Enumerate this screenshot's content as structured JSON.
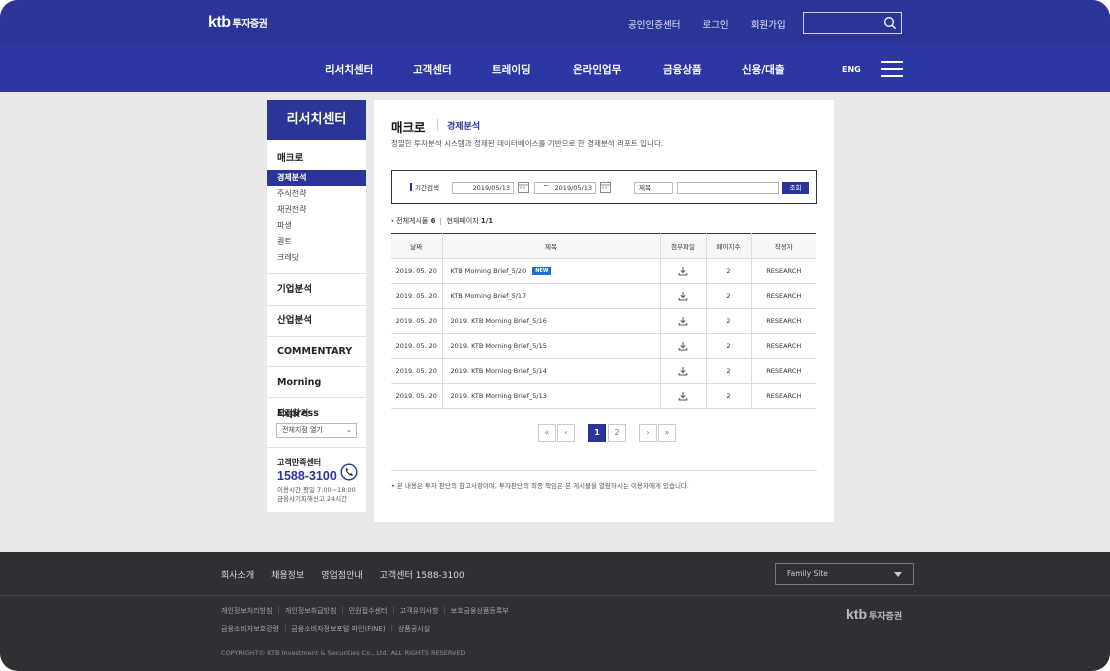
{
  "header": {
    "logo_main": "ktb",
    "logo_sub": "투자증권",
    "top_links": [
      "공인인증센터",
      "로그인",
      "회원가입"
    ],
    "search_placeholder": "",
    "nav": [
      "리서치센터",
      "고객센터",
      "트레이딩",
      "온라인업무",
      "금융상품",
      "신용/대출"
    ],
    "lang": "ENG",
    "colors": {
      "primary": "#2b3597"
    }
  },
  "sidebar": {
    "title": "리서치센터",
    "section": "매크로",
    "sub_items": [
      "경제분석",
      "주식전략",
      "채권전략",
      "파생",
      "퀀트",
      "크레딧"
    ],
    "active_index": 0,
    "blocks": [
      "기업분석",
      "산업분석",
      "COMMENTARY",
      "Morning Express"
    ],
    "branch_label": "지점찾기",
    "branch_select": "전체지점 열기",
    "cs_label": "고객만족센터",
    "cs_number": "1588-3100",
    "cs_hours_1": "이용시간 평일 7:00~18:00",
    "cs_hours_2": "금융사기피해신고 24시간"
  },
  "main": {
    "crumb_main": "매크로",
    "crumb_sub": "경제분석",
    "description": "정밀한 투자분석 시스템과 정제된 데이터베이스를 기반으로 한 경제분석 리포트 입니다.",
    "filter": {
      "label": "기간검색",
      "date_from": "2019/05/13",
      "tilde": "~",
      "date_to": "2019/05/13",
      "field": "제목",
      "keyword": "",
      "search_button": "조회"
    },
    "count_label": "전체게시물",
    "count_value": "6",
    "page_label": "현재페이지",
    "page_value": "1/1",
    "columns": [
      "날짜",
      "제목",
      "첨부파일",
      "페이지수",
      "작성자"
    ],
    "rows": [
      {
        "date": "2019. 05. 20",
        "title": "KTB Morning Brief_5/20",
        "new": "NEW",
        "pages": "2",
        "author": "RESEARCH"
      },
      {
        "date": "2019. 05. 20",
        "title": "KTB Morning Brief_5/17",
        "new": "",
        "pages": "2",
        "author": "RESEARCH"
      },
      {
        "date": "2019. 05. 20",
        "title": "2019. KTB Morning Brief_5/16",
        "new": "",
        "pages": "2",
        "author": "RESEARCH"
      },
      {
        "date": "2019. 05. 20",
        "title": "2019. KTB Morning Brief_5/15",
        "new": "",
        "pages": "2",
        "author": "RESEARCH"
      },
      {
        "date": "2019. 05. 20",
        "title": "2019. KTB Morning Brief_5/14",
        "new": "",
        "pages": "2",
        "author": "RESEARCH"
      },
      {
        "date": "2019. 05. 20",
        "title": "2019. KTB Morning Brief_5/13",
        "new": "",
        "pages": "2",
        "author": "RESEARCH"
      }
    ],
    "pager": {
      "first": "«",
      "prev": "‹",
      "pages": [
        "1",
        "2"
      ],
      "next": "›",
      "last": "»"
    },
    "note": "본 내용은 투자 판단의 참고사항이며, 투자판단의 최종 책임은 본 게시물을 열람하시는 이용자에게 있습니다."
  },
  "footer": {
    "links": [
      "회사소개",
      "채용정보",
      "영업점안내",
      "고객센터 1588-3100"
    ],
    "family_site": "Family Site",
    "policy_row1": [
      "개인정보처리방침",
      "개인정보취급방침",
      "민원접수센터",
      "고객유의사항",
      "보호금융상품등록부"
    ],
    "policy_row2": [
      "금융소비자보호강령",
      "금융소비자정보포털 파인(FINE)",
      "상품공시실"
    ],
    "copyright": "COPYRIGHT© KTB Investment & Securities Co., Ltd. ALL RIGHTS RESERVED",
    "logo_main": "ktb",
    "logo_sub": "투자증권"
  }
}
